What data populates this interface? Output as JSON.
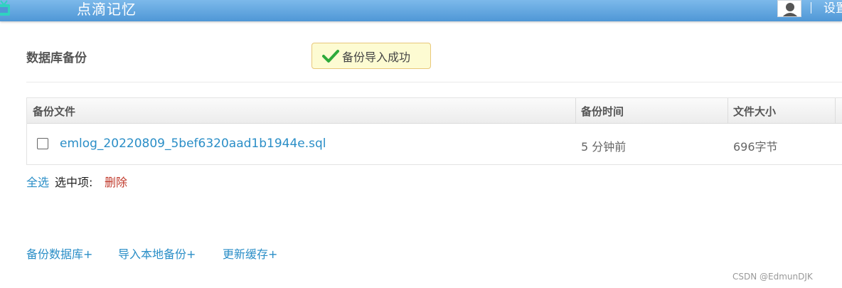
{
  "header": {
    "site_title": "点滴记忆",
    "settings_label": "设置",
    "logo_icon": "tv-logo-icon",
    "avatar_icon": "user-avatar-icon"
  },
  "page": {
    "title": "数据库备份",
    "alert": {
      "icon": "check-icon",
      "text": "备份导入成功",
      "color": "#2eaa3a"
    }
  },
  "table": {
    "headers": [
      "备份文件",
      "备份时间",
      "文件大小"
    ],
    "rows": [
      {
        "file": "emlog_20220809_5bef6320aad1b1944e.sql",
        "time": "5 分钟前",
        "size": "696字节"
      }
    ]
  },
  "actions": {
    "select_all": "全选",
    "selected_label": "选中项:",
    "delete": "删除"
  },
  "bottom_links": [
    "备份数据库+",
    "导入本地备份+",
    "更新缓存+"
  ],
  "watermark": "CSDN @EdmunDJK"
}
